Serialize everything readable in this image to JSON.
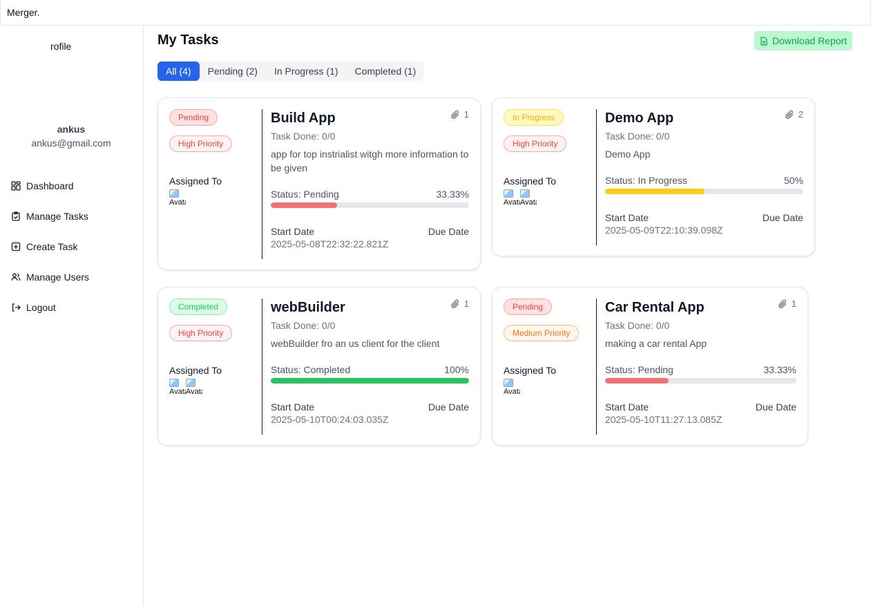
{
  "app": {
    "title": "Merger."
  },
  "sidebar": {
    "profile_alt": "rofile",
    "user_name": "ankus",
    "user_email": "ankus@gmail.com",
    "items": [
      {
        "label": "Dashboard",
        "icon": "grid-icon"
      },
      {
        "label": "Manage Tasks",
        "icon": "clipboard-check-icon"
      },
      {
        "label": "Create Task",
        "icon": "square-plus-icon"
      },
      {
        "label": "Manage Users",
        "icon": "users-icon"
      },
      {
        "label": "Logout",
        "icon": "logout-icon"
      }
    ]
  },
  "main": {
    "title": "My Tasks",
    "download_label": "Download Report",
    "tabs": [
      {
        "label": "All (4)"
      },
      {
        "label": "Pending (2)"
      },
      {
        "label": "In Progress (1)"
      },
      {
        "label": "Completed (1)"
      }
    ]
  },
  "cards": [
    {
      "status_badge": "Pending",
      "priority_badge": "High Priority",
      "assigned_label": "Assigned To",
      "avatar_alt": "Avatar",
      "title": "Build App",
      "attachments": "1",
      "task_done": "Task Done: 0/0",
      "description": "app for top instrialist witgh more information to be given",
      "status_text": "Status: Pending",
      "percent": "33.33%",
      "progress": 33.33,
      "start_label": "Start Date",
      "start_value": "2025-05-08T22:32:22.821Z",
      "due_label": "Due Date"
    },
    {
      "status_badge": "In Progress",
      "priority_badge": "High Priority",
      "assigned_label": "Assigned To",
      "avatar_alt": "Avatar",
      "title": "Demo App",
      "attachments": "2",
      "task_done": "Task Done: 0/0",
      "description": "Demo App",
      "status_text": "Status: In Progress",
      "percent": "50%",
      "progress": 50,
      "start_label": "Start Date",
      "start_value": "2025-05-09T22:10:39.098Z",
      "due_label": "Due Date"
    },
    {
      "status_badge": "Completed",
      "priority_badge": "High Priority",
      "assigned_label": "Assigned To",
      "avatar_alt": "Avatar",
      "title": "webBuilder",
      "attachments": "1",
      "task_done": "Task Done: 0/0",
      "description": "webBuilder fro an us client for the client",
      "status_text": "Status: Completed",
      "percent": "100%",
      "progress": 100,
      "start_label": "Start Date",
      "start_value": "2025-05-10T00:24:03.035Z",
      "due_label": "Due Date"
    },
    {
      "status_badge": "Pending",
      "priority_badge": "Medium Priority",
      "assigned_label": "Assigned To",
      "avatar_alt": "Avatar",
      "title": "Car Rental App",
      "attachments": "1",
      "task_done": "Task Done: 0/0",
      "description": "making a car rental App",
      "status_text": "Status: Pending",
      "percent": "33.33%",
      "progress": 33.33,
      "start_label": "Start Date",
      "start_value": "2025-05-10T11:27:13.085Z",
      "due_label": "Due Date"
    }
  ],
  "colors": {
    "accent": "#2563eb",
    "pending_bar": "#f87171",
    "progress_bar": "#facc15",
    "completed_bar": "#22c55e"
  }
}
